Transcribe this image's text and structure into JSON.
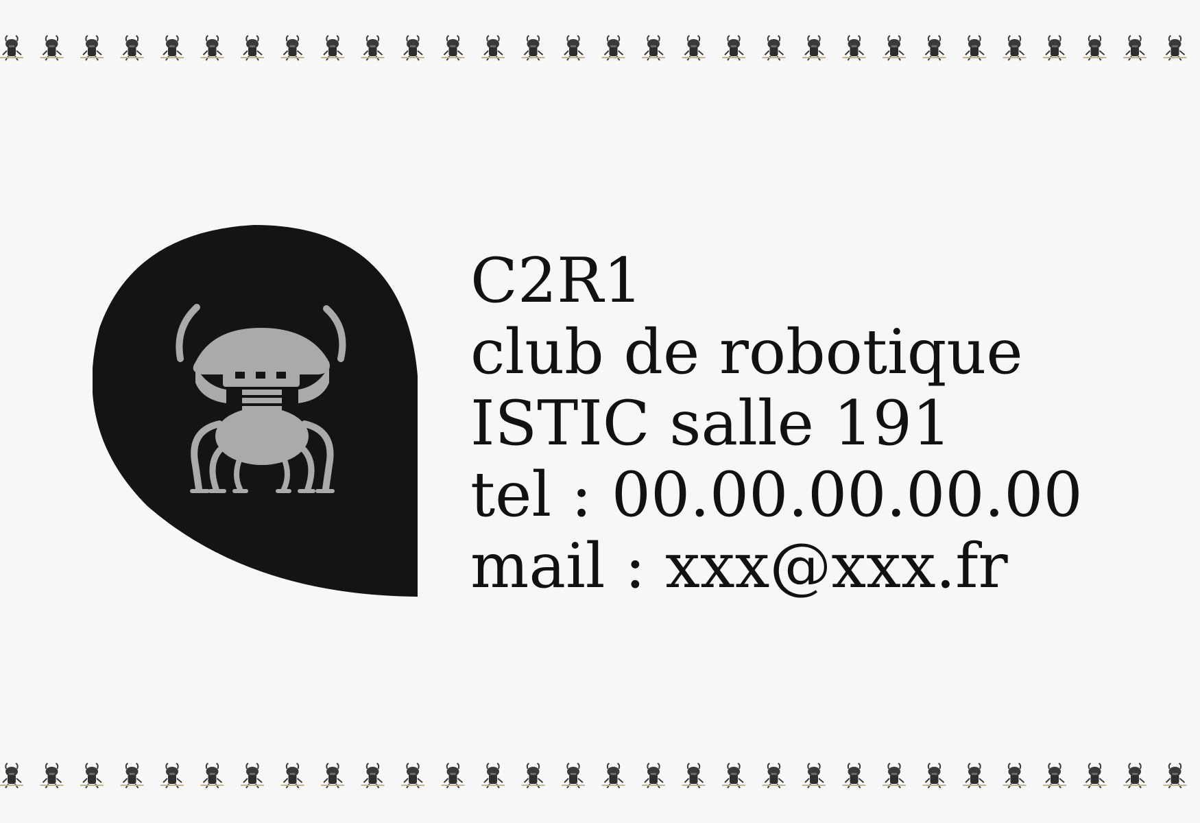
{
  "card": {
    "lines": [
      "C2R1",
      "club de robotique",
      "ISTIC salle 191",
      "tel : 00.00.00.00.00",
      "mail : xxx@xxx.fr"
    ]
  },
  "logo": {
    "icon": "robot-beetle-icon",
    "background_color": "#141414",
    "figure_color": "#aaaaaa"
  },
  "border": {
    "icon": "robot-beetle-icon",
    "color": "#3a3a3a",
    "accent_color": "#c8b48c"
  }
}
